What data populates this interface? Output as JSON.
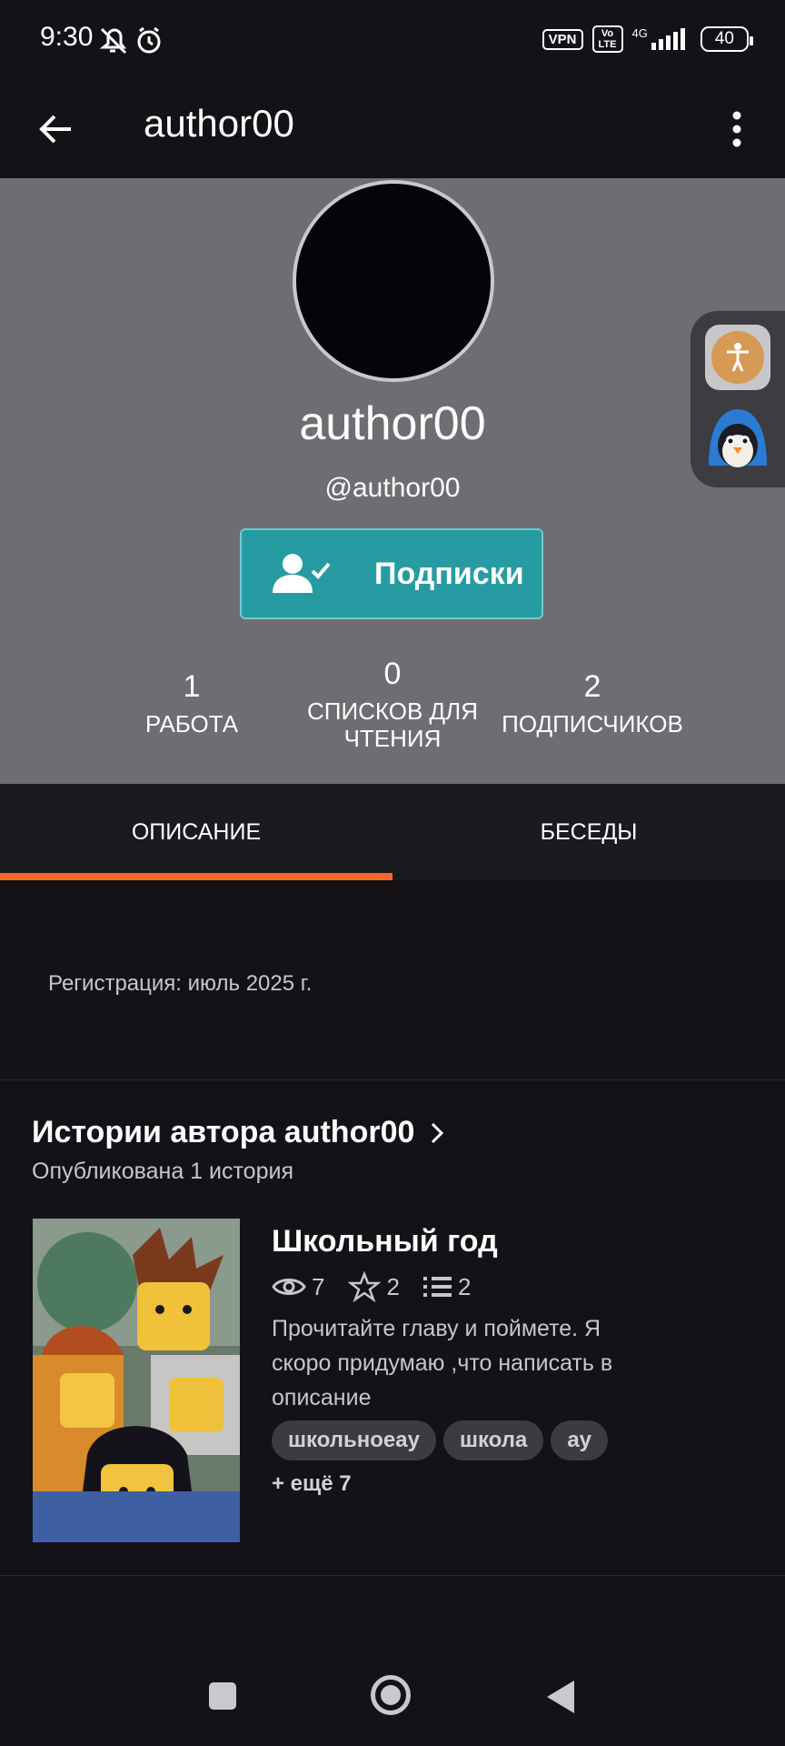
{
  "status_bar": {
    "time": "9:30",
    "vpn": "VPN",
    "volte": "Vo LTE",
    "network": "4G",
    "battery": "40"
  },
  "app_bar": {
    "title": "author00",
    "back_icon": "arrow-left-icon",
    "more_icon": "more-vertical-icon"
  },
  "profile": {
    "name": "author00",
    "handle": "@author00",
    "follow_button_label": "Подписки",
    "stats": [
      {
        "value": "1",
        "label": "РАБОТА"
      },
      {
        "value": "0",
        "label": "СПИСКОВ ДЛЯ ЧТЕНИЯ"
      },
      {
        "value": "2",
        "label": "ПОДПИСЧИКОВ"
      }
    ]
  },
  "tabs": [
    {
      "label": "ОПИСАНИЕ",
      "active": true
    },
    {
      "label": "БЕСЕДЫ",
      "active": false
    }
  ],
  "about": {
    "registration": "Регистрация: июль 2025 г."
  },
  "stories_section": {
    "title": "Истории автора author00",
    "subtitle": "Опубликована 1 история"
  },
  "story": {
    "title": "Школьный год",
    "views": "7",
    "votes": "2",
    "parts": "2",
    "description": "Прочитайте главу и поймете. Я скоро придумаю ,что написать в описание",
    "tags": [
      "школьноеау",
      "школа",
      "ау"
    ],
    "more_tags": "+ ещё 7"
  },
  "colors": {
    "accent": "#f3682a",
    "follow_button": "#279ba2",
    "header_bg": "#6e6d72",
    "page_bg": "#141216"
  }
}
